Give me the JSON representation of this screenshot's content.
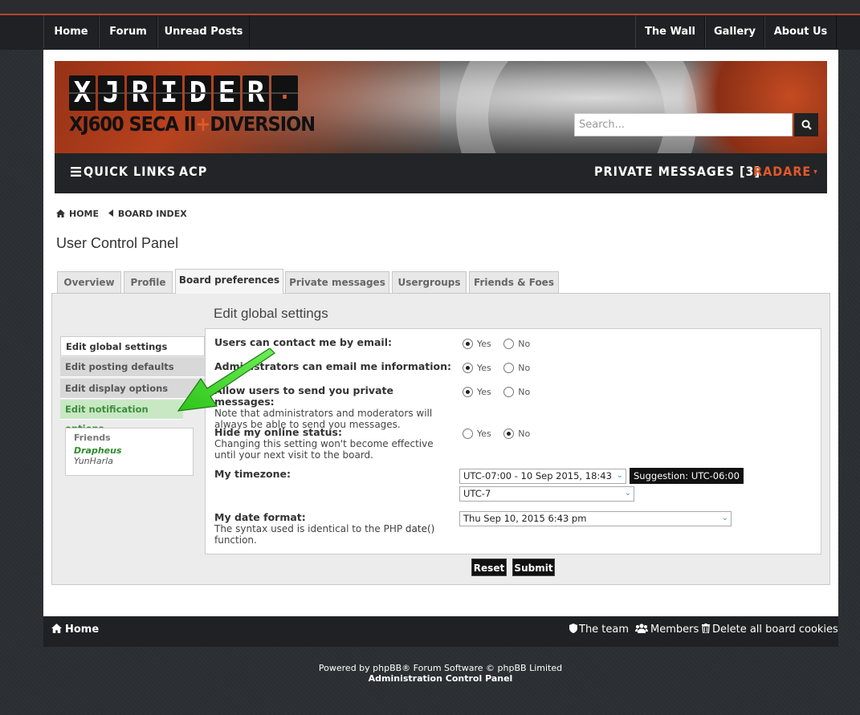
{
  "topnav": {
    "left": [
      "Home",
      "Forum",
      "Unread Posts"
    ],
    "right": [
      "The Wall",
      "Gallery",
      "About Us"
    ]
  },
  "banner": {
    "logo_letters": [
      "X",
      "J",
      "R",
      "I",
      "D",
      "E",
      "R",
      "."
    ],
    "logo_sub_a": "XJ600 SECA II",
    "logo_sub_plus": "+",
    "logo_sub_b": "DIVERSION",
    "search_placeholder": "Search..."
  },
  "navbar": {
    "quick_links": "QUICK LINKS",
    "acp": "ACP",
    "private_messages": "PRIVATE MESSAGES [3]",
    "user": "RADARE",
    "user_caret": "▾"
  },
  "breadcrumbs": {
    "home": "HOME",
    "board_index": "BOARD INDEX"
  },
  "page_title": "User Control Panel",
  "tabs": [
    "Overview",
    "Profile",
    "Board preferences",
    "Private messages",
    "Usergroups",
    "Friends & Foes"
  ],
  "panel": {
    "title": "Edit global settings",
    "sidebar": [
      "Edit global settings",
      "Edit posting defaults",
      "Edit display options",
      "Edit notification options"
    ],
    "friends_header": "Friends",
    "friends": [
      "Drapheus",
      "YunHarla"
    ]
  },
  "form": {
    "yes": "Yes",
    "no": "No",
    "q1": "Users can contact me by email:",
    "q2": "Administrators can email me information:",
    "q3": "Allow users to send you private messages:",
    "q3_exp": "Note that administrators and moderators will always be able to send you messages.",
    "q4": "Hide my online status:",
    "q4_exp": "Changing this setting won't become effective until your next visit to the board.",
    "timezone_label": "My timezone:",
    "timezone_value": "UTC-07:00 - 10 Sep 2015, 18:43",
    "timezone_suggest": "Suggestion: UTC-06:00",
    "timezone_zone": "UTC-7",
    "date_label": "My date format:",
    "date_exp_pre": "The syntax used is identical to the PHP",
    "date_exp_fn": "date()",
    "date_exp_post": "function.",
    "date_value": "Thu Sep 10, 2015 6:43 pm",
    "reset": "Reset",
    "submit": "Submit"
  },
  "footer": {
    "home": "Home",
    "team": "The team",
    "members": "Members",
    "delete_cookies": "Delete all board cookies"
  },
  "powered": {
    "line1": "Powered by phpBB® Forum Software © phpBB Limited",
    "line2": "Administration Control Panel"
  },
  "colors": {
    "accent_orange": "#e0592a",
    "highlight_green": "#2e8b2e",
    "arrow_green": "#32d11e"
  }
}
